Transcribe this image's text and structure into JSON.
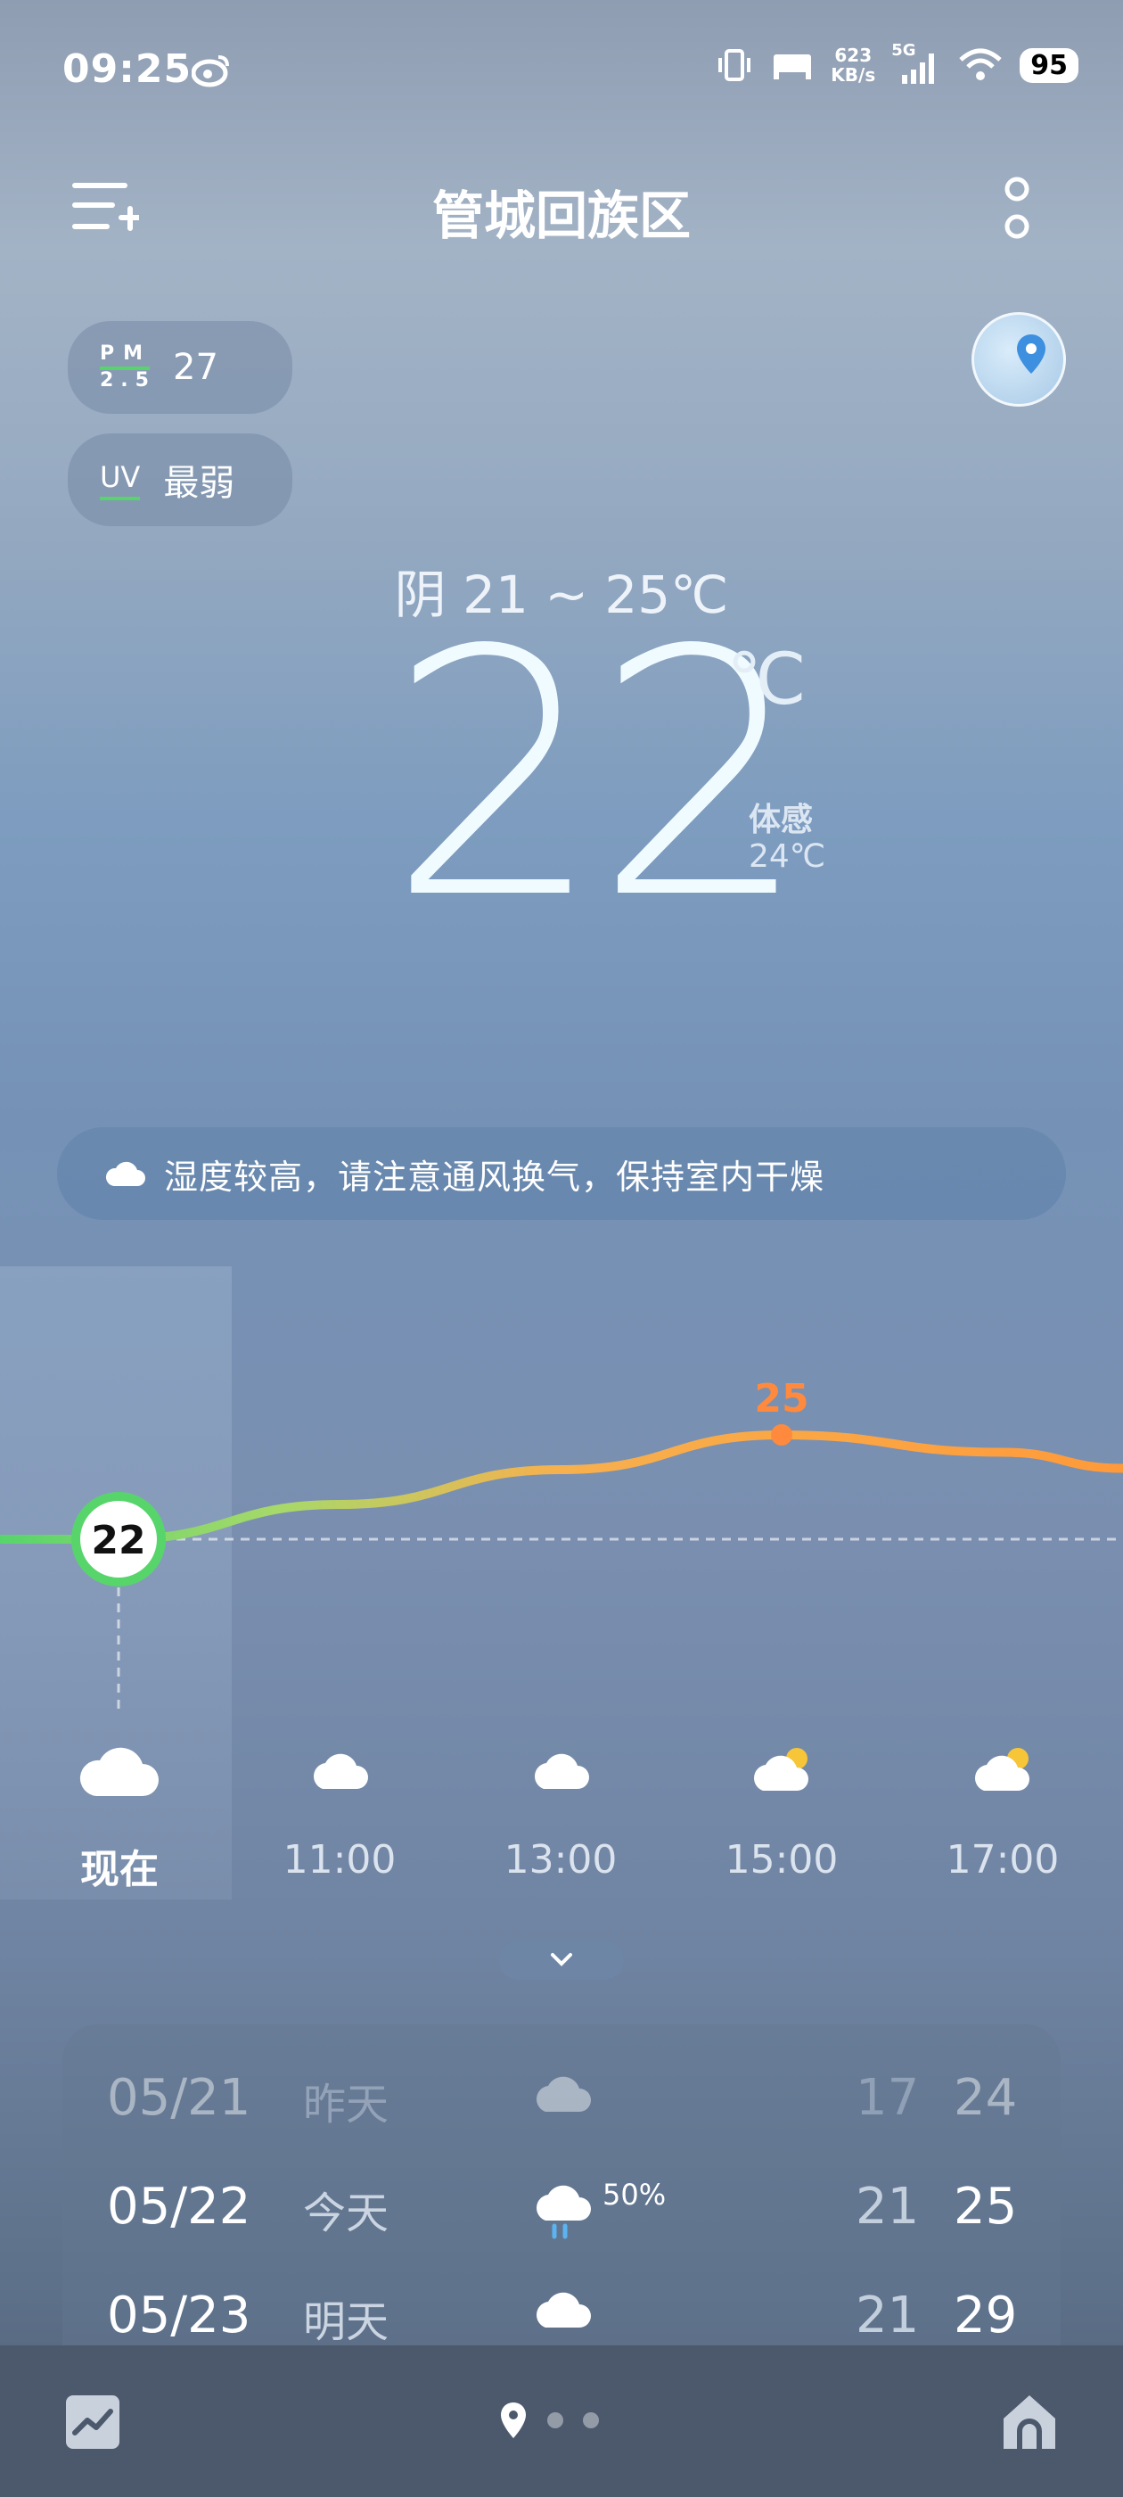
{
  "status_bar": {
    "time": "09:25",
    "net_speed_value": "623",
    "net_speed_unit": "KB/s",
    "network_type": "5G",
    "battery": "95"
  },
  "header": {
    "title": "管城回族区"
  },
  "air": {
    "pm_label_top": "PM",
    "pm_label_bottom": "2.5",
    "pm_value": "27",
    "uv_label": "UV",
    "uv_value": "最弱"
  },
  "current": {
    "range_text": "阴  21 ~ 25℃",
    "temperature": "22",
    "unit": "℃",
    "feels_label": "体感",
    "feels_value": "24℃"
  },
  "tip": {
    "text": "湿度较高，请注意通风换气，保持室内干燥"
  },
  "hourly": {
    "now_temp": "22",
    "peak_temp": "25",
    "labels": [
      "现在",
      "11:00",
      "13:00",
      "15:00",
      "17:00"
    ],
    "icons": [
      "cloud-icon",
      "cloud-icon",
      "cloud-icon",
      "partly-sunny-icon",
      "partly-sunny-icon"
    ],
    "temps": [
      22,
      23,
      24,
      25,
      24.5
    ]
  },
  "daily": [
    {
      "date": "05/21",
      "day": "昨天",
      "icon": "cloud-icon",
      "precip": "",
      "low": "17",
      "high": "24"
    },
    {
      "date": "05/22",
      "day": "今天",
      "icon": "rain-icon",
      "precip": "50%",
      "low": "21",
      "high": "25"
    },
    {
      "date": "05/23",
      "day": "明天",
      "icon": "cloud-icon",
      "precip": "",
      "low": "21",
      "high": "29"
    }
  ],
  "colors": {
    "green": "#57d56b",
    "orange": "#ff8a3d"
  }
}
